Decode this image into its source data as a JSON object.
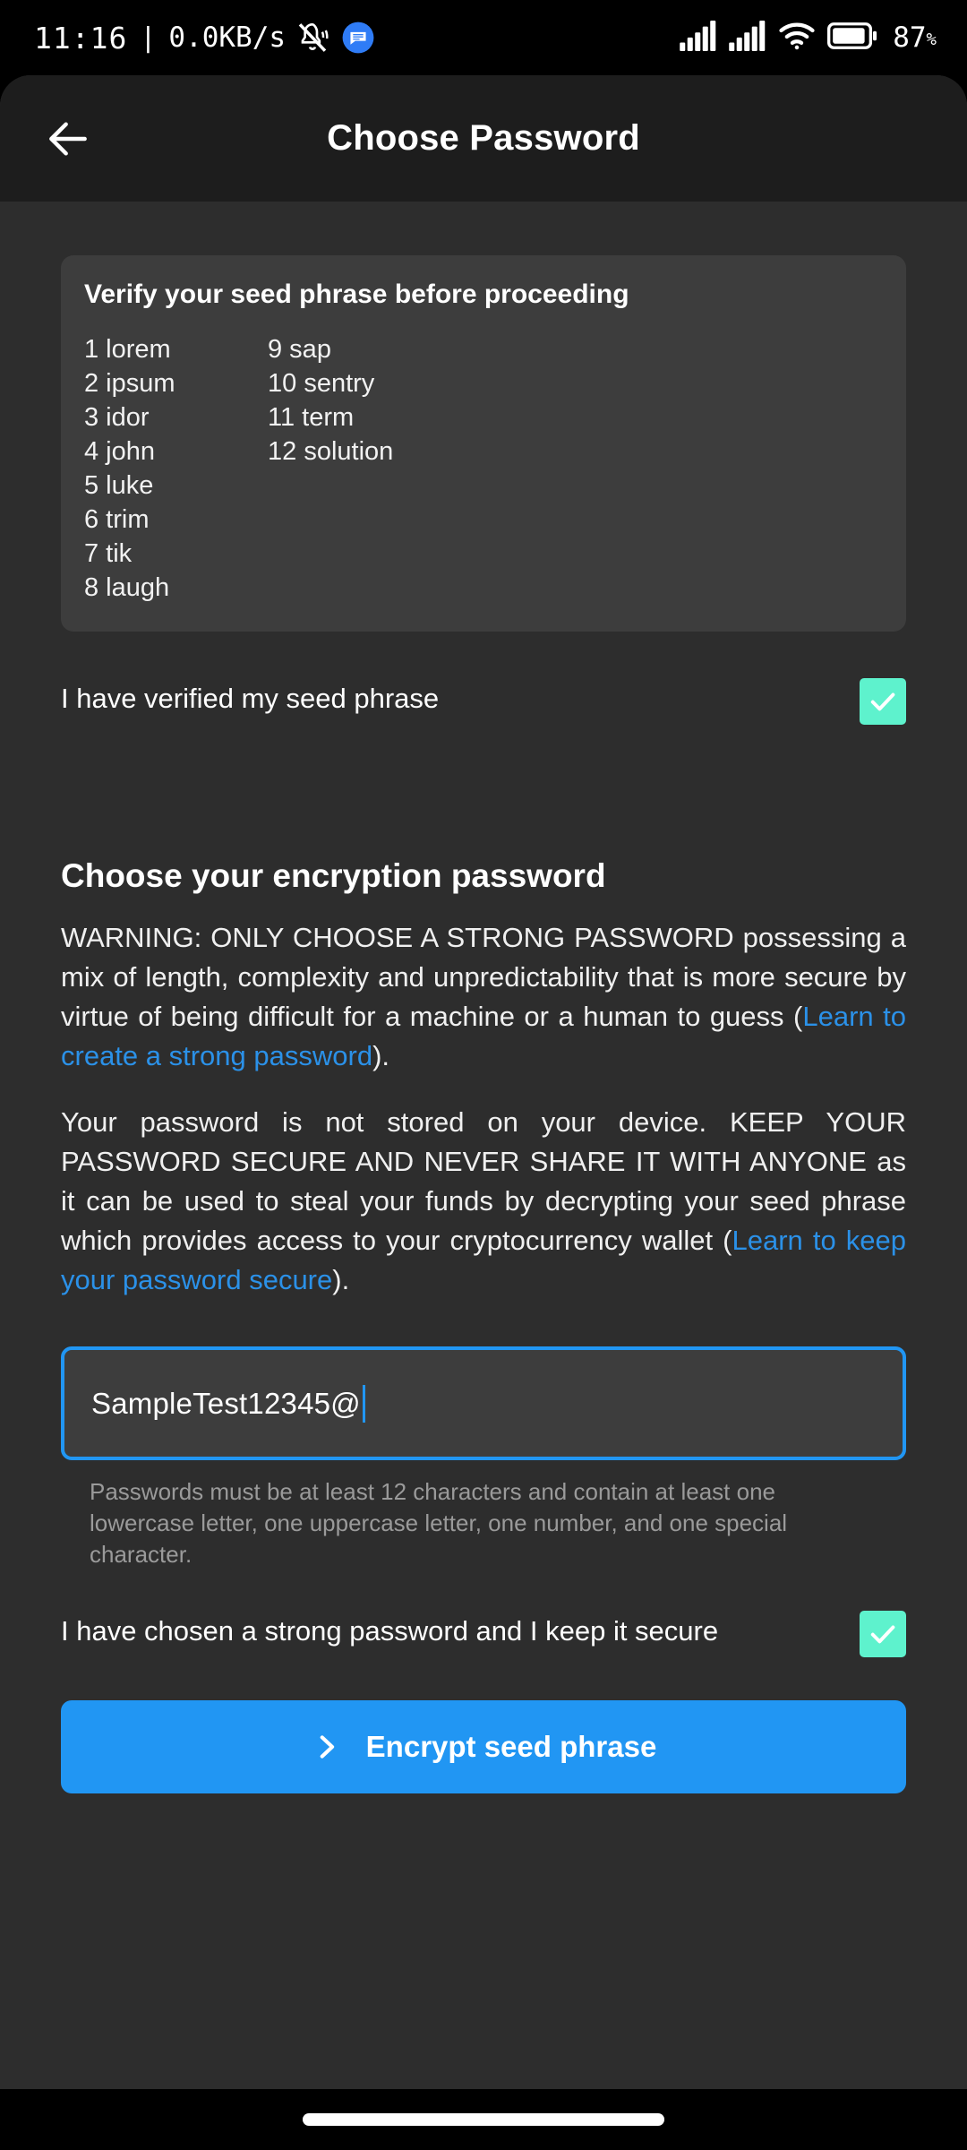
{
  "status_bar": {
    "time": "11:16",
    "separator": "|",
    "network_speed": "0.0KB/s",
    "battery_percent": "87",
    "percent_symbol": "%",
    "icons": [
      "bell-muted-icon",
      "messages-icon",
      "signal-bars-icon",
      "signal-bars-2-icon",
      "wifi-icon",
      "battery-icon"
    ]
  },
  "app_bar": {
    "back_label": "Back",
    "title": "Choose Password"
  },
  "seed_card": {
    "title": "Verify your seed phrase before proceeding",
    "column_left": [
      "1 lorem",
      "2 ipsum",
      "3 idor",
      "4 john",
      "5 luke",
      "6 trim",
      "7 tik",
      "8 laugh"
    ],
    "column_right": [
      "9 sap",
      "10 sentry",
      "11 term",
      "12 solution"
    ]
  },
  "verify_check": {
    "label": "I have verified my seed phrase",
    "checked": true
  },
  "password_section": {
    "heading": "Choose your encryption password",
    "paragraph_1_part_1": "WARNING: ONLY CHOOSE A STRONG PASSWORD possessing a mix of length, complexity and unpredictability that is more secure by virtue of being difficult for a machine or a human to guess (",
    "paragraph_1_link": "Learn to create a strong password",
    "paragraph_1_part_2": ").",
    "paragraph_2_part_1": "Your password is not stored on your device. KEEP YOUR PASSWORD SECURE AND NEVER SHARE IT WITH ANYONE as it can be used to steal your funds by decrypting your seed phrase which provides access to your cryptocurrency wallet (",
    "paragraph_2_link": "Learn to keep your password secure",
    "paragraph_2_part_2": ")."
  },
  "password_input": {
    "value": "SampleTest12345@",
    "placeholder": "Password",
    "focused": true
  },
  "helper_text": "Passwords must be at least 12 characters and contain at least one lowercase letter, one uppercase letter, one number, and one special character.",
  "strong_check": {
    "label": "I have chosen a strong password and I keep it secure",
    "checked": true
  },
  "cta": {
    "label": "Encrypt seed phrase",
    "icon": "chevron-right-icon"
  },
  "colors": {
    "page_background": "#2d2d2d",
    "app_bar_background": "#1d1d1d",
    "card_background": "#3d3d3d",
    "accent_blue": "#2196f3",
    "link_blue": "#2b91e8",
    "checkbox_green": "#5ef2cd",
    "text_primary": "#ffffff",
    "text_muted": "#9a9a9a"
  }
}
